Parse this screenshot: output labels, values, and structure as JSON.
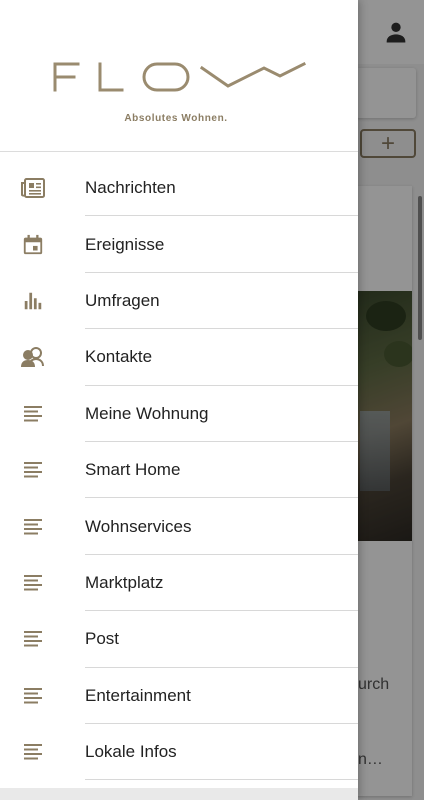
{
  "background": {
    "add_button_label": "+",
    "text_line_1": "urch",
    "text_line_2": "n…"
  },
  "drawer": {
    "logo_text": "FLOW",
    "tagline": "Absolutes Wohnen.",
    "items": [
      {
        "label": "Nachrichten",
        "icon": "newspaper-icon"
      },
      {
        "label": "Ereignisse",
        "icon": "calendar-icon"
      },
      {
        "label": "Umfragen",
        "icon": "bar-chart-icon"
      },
      {
        "label": "Kontakte",
        "icon": "contacts-icon"
      },
      {
        "label": "Meine Wohnung",
        "icon": "lines-icon"
      },
      {
        "label": "Smart Home",
        "icon": "lines-icon"
      },
      {
        "label": "Wohnservices",
        "icon": "lines-icon"
      },
      {
        "label": "Marktplatz",
        "icon": "lines-icon"
      },
      {
        "label": "Post",
        "icon": "lines-icon"
      },
      {
        "label": "Entertainment",
        "icon": "lines-icon"
      },
      {
        "label": "Lokale Infos",
        "icon": "lines-icon"
      }
    ]
  },
  "colors": {
    "brand": "#8b7d63",
    "icon": "#8b7d63"
  }
}
